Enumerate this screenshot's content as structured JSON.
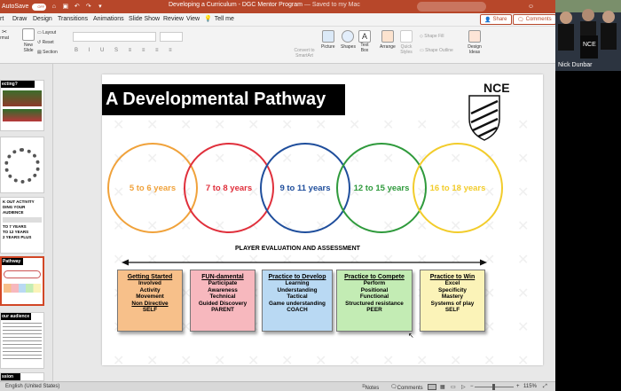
{
  "titlebar": {
    "autosave": "AutoSave",
    "toggle": "OFF",
    "title": "Developing a Curriculum - DGC Mentor Program",
    "saved": "— Saved to my Mac"
  },
  "menu": {
    "items": [
      "rt",
      "Draw",
      "Design",
      "Transitions",
      "Animations",
      "Slide Show",
      "Review",
      "View"
    ],
    "tell_me": "Tell me",
    "share": "Share",
    "comments": "Comments"
  },
  "ribbon": {
    "rmat": "rmat",
    "new_slide": "New Slide",
    "layout": "Layout",
    "reset": "Reset",
    "section": "Section",
    "convert": "Convert to SmartArt",
    "picture": "Picture",
    "shapes": "Shapes",
    "text_box": "Text Box",
    "arrange": "Arrange",
    "quick_styles": "Quick Styles",
    "shape_fill": "Shape Fill",
    "shape_outline": "Shape Outline",
    "design_ideas": "Design Ideas"
  },
  "sidebar": {
    "thumb1": "ecting?",
    "thumb4_lines": [
      "K OUT ACTIVITY",
      "DING YOUR AUDIENCE",
      "TO 7 YEARS",
      "TO 12 YEARS",
      "2 YEARS PLUS"
    ],
    "thumb5": "Pathway",
    "thumb6": "our audience",
    "thumb7": "ssion"
  },
  "slide": {
    "title": "A Developmental Pathway",
    "logo_text": "NCE",
    "age_groups": [
      {
        "label": "5 to 6 years",
        "color": "#f0a23b"
      },
      {
        "label": "7 to 8 years",
        "color": "#e0303c"
      },
      {
        "label": "9 to 11 years",
        "color": "#1f4e9c"
      },
      {
        "label": "12 to 15 years",
        "color": "#2f9a3c"
      },
      {
        "label": "16 to 18 years",
        "color": "#f2cc2b"
      }
    ],
    "evaluation": "PLAYER EVALUATION AND ASSESSMENT",
    "stages": [
      {
        "heading": "Getting Started",
        "items": [
          "Involved",
          "Activity",
          "Movement",
          "Non Directive",
          "SELF"
        ],
        "color": "#f7c08a"
      },
      {
        "heading": "FUN-damental",
        "items": [
          "Participate",
          "Awareness",
          "Technical",
          "Guided Discovery",
          "PARENT"
        ],
        "color": "#f7b8be"
      },
      {
        "heading": "Practice to Develop",
        "items": [
          "Learning",
          "Understanding",
          "Tactical",
          "Game understanding",
          "COACH"
        ],
        "color": "#b9d9f3"
      },
      {
        "heading": "Practice to Compete",
        "items": [
          "Perform",
          "Positional",
          "Functional",
          "Structured resistance",
          "PEER"
        ],
        "color": "#c3ecb4"
      },
      {
        "heading": "Practice to Win",
        "items": [
          "Excel",
          "Specificity",
          "Mastery",
          "Systems of play",
          "SELF"
        ],
        "color": "#fbf3b8"
      }
    ]
  },
  "video": {
    "name": "Nick Dunbar"
  },
  "statusbar": {
    "language": "English (United States)",
    "notes": "Notes",
    "comments": "Comments",
    "zoom": "115%"
  }
}
